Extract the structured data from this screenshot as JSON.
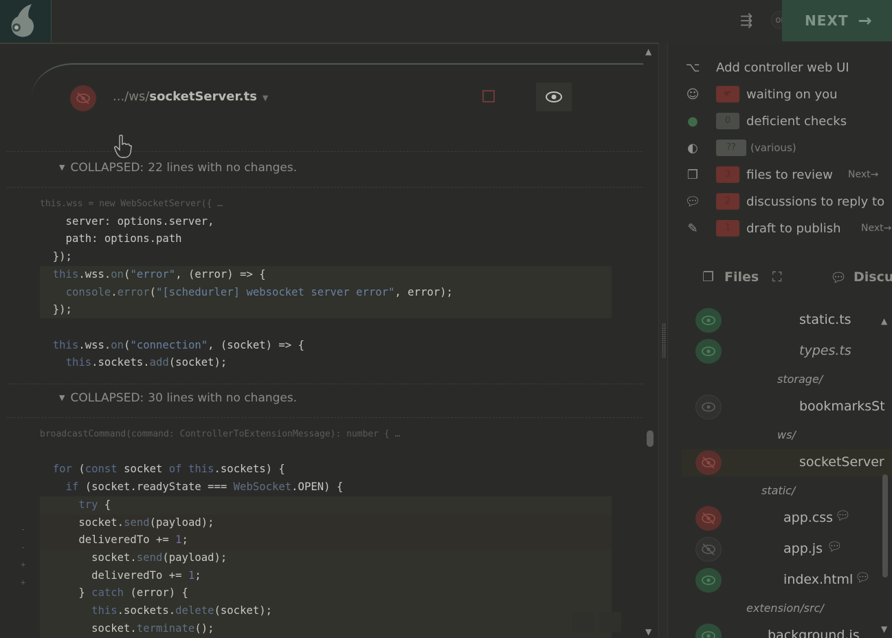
{
  "topbar": {
    "or_label": "or",
    "next_label": "NEXT",
    "next_arrow": "→"
  },
  "file": {
    "path_prefix": ".../ws/",
    "filename": "socketServer.ts"
  },
  "collapsed": [
    {
      "label": "COLLAPSED:",
      "text": "22 lines with no changes."
    },
    {
      "label": "COLLAPSED:",
      "text": "30 lines with no changes."
    }
  ],
  "summary": {
    "title": "Add controller web UI",
    "waiting": "waiting on you",
    "checks_count": "0",
    "checks": "deficient checks",
    "various_badge": "??",
    "various": "(various)",
    "files_count": "3",
    "files": "files to review",
    "files_next": "Next",
    "discussions_count": "2",
    "discussions": "discussions to reply to",
    "draft_count": "1",
    "draft": "draft to publish",
    "draft_next": "Next"
  },
  "tabs": {
    "files": "Files",
    "discussions": "Discuss"
  },
  "tree": {
    "static_ts": "static.ts",
    "types_ts": "types.ts",
    "storage": "storage/",
    "bookmarks": "bookmarksSt",
    "ws": "ws/",
    "socket_server": "socketServer",
    "static_dir": "static/",
    "app_css": "app.css",
    "app_js": "app.js",
    "index_html": "index.html",
    "extension_src": "extension/src/",
    "background_js": "background.js"
  }
}
